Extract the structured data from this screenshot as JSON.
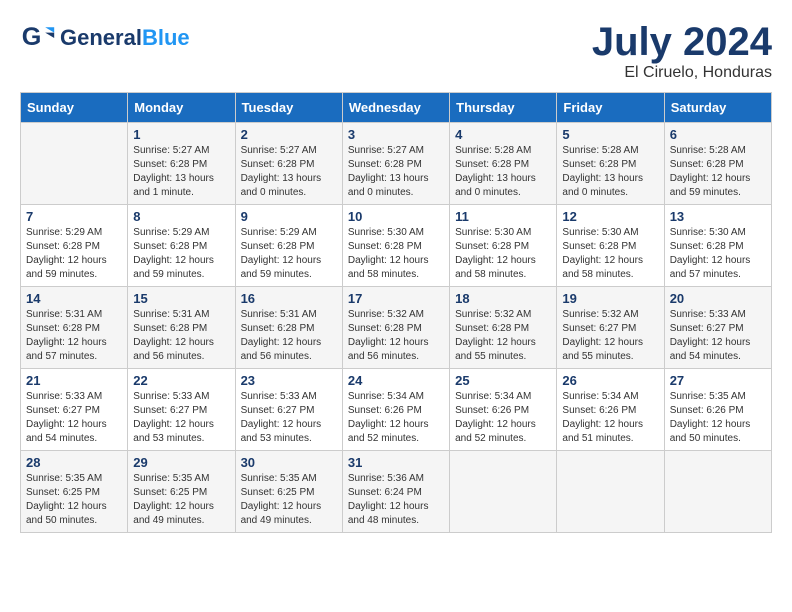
{
  "header": {
    "logo_general": "General",
    "logo_blue": "Blue",
    "month_title": "July 2024",
    "location": "El Ciruelo, Honduras"
  },
  "weekdays": [
    "Sunday",
    "Monday",
    "Tuesday",
    "Wednesday",
    "Thursday",
    "Friday",
    "Saturday"
  ],
  "weeks": [
    [
      {
        "day": "",
        "info": ""
      },
      {
        "day": "1",
        "info": "Sunrise: 5:27 AM\nSunset: 6:28 PM\nDaylight: 13 hours\nand 1 minute."
      },
      {
        "day": "2",
        "info": "Sunrise: 5:27 AM\nSunset: 6:28 PM\nDaylight: 13 hours\nand 0 minutes."
      },
      {
        "day": "3",
        "info": "Sunrise: 5:27 AM\nSunset: 6:28 PM\nDaylight: 13 hours\nand 0 minutes."
      },
      {
        "day": "4",
        "info": "Sunrise: 5:28 AM\nSunset: 6:28 PM\nDaylight: 13 hours\nand 0 minutes."
      },
      {
        "day": "5",
        "info": "Sunrise: 5:28 AM\nSunset: 6:28 PM\nDaylight: 13 hours\nand 0 minutes."
      },
      {
        "day": "6",
        "info": "Sunrise: 5:28 AM\nSunset: 6:28 PM\nDaylight: 12 hours\nand 59 minutes."
      }
    ],
    [
      {
        "day": "7",
        "info": "Sunrise: 5:29 AM\nSunset: 6:28 PM\nDaylight: 12 hours\nand 59 minutes."
      },
      {
        "day": "8",
        "info": "Sunrise: 5:29 AM\nSunset: 6:28 PM\nDaylight: 12 hours\nand 59 minutes."
      },
      {
        "day": "9",
        "info": "Sunrise: 5:29 AM\nSunset: 6:28 PM\nDaylight: 12 hours\nand 59 minutes."
      },
      {
        "day": "10",
        "info": "Sunrise: 5:30 AM\nSunset: 6:28 PM\nDaylight: 12 hours\nand 58 minutes."
      },
      {
        "day": "11",
        "info": "Sunrise: 5:30 AM\nSunset: 6:28 PM\nDaylight: 12 hours\nand 58 minutes."
      },
      {
        "day": "12",
        "info": "Sunrise: 5:30 AM\nSunset: 6:28 PM\nDaylight: 12 hours\nand 58 minutes."
      },
      {
        "day": "13",
        "info": "Sunrise: 5:30 AM\nSunset: 6:28 PM\nDaylight: 12 hours\nand 57 minutes."
      }
    ],
    [
      {
        "day": "14",
        "info": "Sunrise: 5:31 AM\nSunset: 6:28 PM\nDaylight: 12 hours\nand 57 minutes."
      },
      {
        "day": "15",
        "info": "Sunrise: 5:31 AM\nSunset: 6:28 PM\nDaylight: 12 hours\nand 56 minutes."
      },
      {
        "day": "16",
        "info": "Sunrise: 5:31 AM\nSunset: 6:28 PM\nDaylight: 12 hours\nand 56 minutes."
      },
      {
        "day": "17",
        "info": "Sunrise: 5:32 AM\nSunset: 6:28 PM\nDaylight: 12 hours\nand 56 minutes."
      },
      {
        "day": "18",
        "info": "Sunrise: 5:32 AM\nSunset: 6:28 PM\nDaylight: 12 hours\nand 55 minutes."
      },
      {
        "day": "19",
        "info": "Sunrise: 5:32 AM\nSunset: 6:27 PM\nDaylight: 12 hours\nand 55 minutes."
      },
      {
        "day": "20",
        "info": "Sunrise: 5:33 AM\nSunset: 6:27 PM\nDaylight: 12 hours\nand 54 minutes."
      }
    ],
    [
      {
        "day": "21",
        "info": "Sunrise: 5:33 AM\nSunset: 6:27 PM\nDaylight: 12 hours\nand 54 minutes."
      },
      {
        "day": "22",
        "info": "Sunrise: 5:33 AM\nSunset: 6:27 PM\nDaylight: 12 hours\nand 53 minutes."
      },
      {
        "day": "23",
        "info": "Sunrise: 5:33 AM\nSunset: 6:27 PM\nDaylight: 12 hours\nand 53 minutes."
      },
      {
        "day": "24",
        "info": "Sunrise: 5:34 AM\nSunset: 6:26 PM\nDaylight: 12 hours\nand 52 minutes."
      },
      {
        "day": "25",
        "info": "Sunrise: 5:34 AM\nSunset: 6:26 PM\nDaylight: 12 hours\nand 52 minutes."
      },
      {
        "day": "26",
        "info": "Sunrise: 5:34 AM\nSunset: 6:26 PM\nDaylight: 12 hours\nand 51 minutes."
      },
      {
        "day": "27",
        "info": "Sunrise: 5:35 AM\nSunset: 6:26 PM\nDaylight: 12 hours\nand 50 minutes."
      }
    ],
    [
      {
        "day": "28",
        "info": "Sunrise: 5:35 AM\nSunset: 6:25 PM\nDaylight: 12 hours\nand 50 minutes."
      },
      {
        "day": "29",
        "info": "Sunrise: 5:35 AM\nSunset: 6:25 PM\nDaylight: 12 hours\nand 49 minutes."
      },
      {
        "day": "30",
        "info": "Sunrise: 5:35 AM\nSunset: 6:25 PM\nDaylight: 12 hours\nand 49 minutes."
      },
      {
        "day": "31",
        "info": "Sunrise: 5:36 AM\nSunset: 6:24 PM\nDaylight: 12 hours\nand 48 minutes."
      },
      {
        "day": "",
        "info": ""
      },
      {
        "day": "",
        "info": ""
      },
      {
        "day": "",
        "info": ""
      }
    ]
  ]
}
